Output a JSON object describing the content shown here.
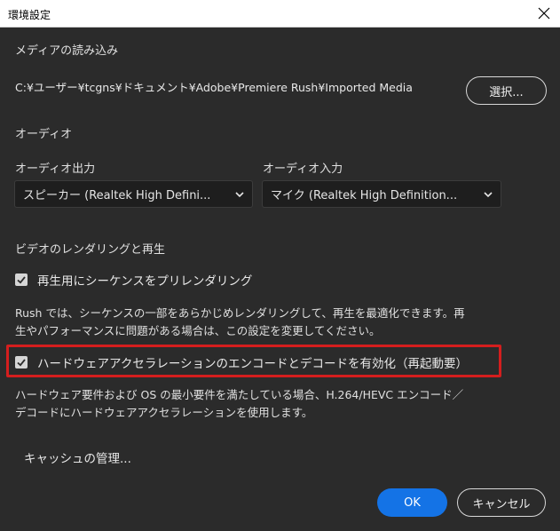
{
  "window": {
    "title": "環境設定",
    "close_icon": "close-icon"
  },
  "media_import": {
    "heading": "メディアの読み込み",
    "path": "C:¥ユーザー¥tcgns¥ドキュメント¥Adobe¥Premiere Rush¥Imported Media",
    "browse_label": "選択..."
  },
  "audio": {
    "heading": "オーディオ",
    "output_label": "オーディオ出力",
    "output_value": "スピーカー (Realtek High Defini...",
    "input_label": "オーディオ入力",
    "input_value": "マイク (Realtek High Definition..."
  },
  "video": {
    "heading": "ビデオのレンダリングと再生",
    "prerender_label": "再生用にシーケンスをプリレンダリング",
    "prerender_checked": true,
    "prerender_desc_line1": "Rush では、シーケンスの一部をあらかじめレンダリングして、再生を最適化できます。再",
    "prerender_desc_line2": "生やパフォーマンスに問題がある場合は、この設定を変更してください。",
    "hw_label": "ハードウェアアクセラレーションのエンコードとデコードを有効化（再起動要）",
    "hw_checked": true,
    "hw_desc_line1": "ハードウェア要件および OS の最小要件を満たしている場合、H.264/HEVC エンコード／",
    "hw_desc_line2": "デコードにハードウェアアクセラレーションを使用します。"
  },
  "cache": {
    "manage_label": "キャッシュの管理..."
  },
  "footer": {
    "ok_label": "OK",
    "cancel_label": "キャンセル"
  },
  "colors": {
    "background": "#2b2b2b",
    "accent": "#1473e6",
    "highlight": "#d41e1e"
  }
}
